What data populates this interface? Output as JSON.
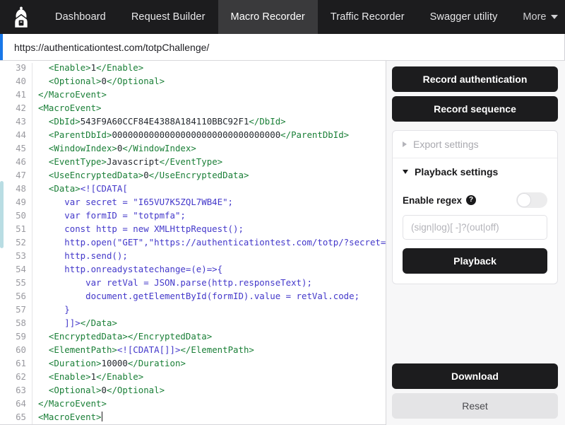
{
  "navbar": {
    "logo_icon": "hooded-spy-logo",
    "tabs": [
      {
        "label": "Dashboard",
        "active": false
      },
      {
        "label": "Request Builder",
        "active": false
      },
      {
        "label": "Macro Recorder",
        "active": true
      },
      {
        "label": "Traffic Recorder",
        "active": false
      },
      {
        "label": "Swagger utility",
        "active": false
      }
    ],
    "more_label": "More",
    "more_caret_icon": "chevron-down-icon",
    "help_icon": "question-mark-circle-icon",
    "help_label": "?"
  },
  "urlbar": {
    "value": "https://authenticationtest.com/totpChallenge/",
    "placeholder": "https://"
  },
  "editor": {
    "first_line_number": 39,
    "lines": [
      {
        "n": 39,
        "segments": [
          {
            "t": "tag",
            "s": "  <Enable>"
          },
          {
            "t": "txt",
            "s": "1"
          },
          {
            "t": "tag",
            "s": "</Enable>"
          }
        ]
      },
      {
        "n": 40,
        "segments": [
          {
            "t": "tag",
            "s": "  <Optional>"
          },
          {
            "t": "txt",
            "s": "0"
          },
          {
            "t": "tag",
            "s": "</Optional>"
          }
        ]
      },
      {
        "n": 41,
        "segments": [
          {
            "t": "tag",
            "s": "</MacroEvent>"
          }
        ]
      },
      {
        "n": 42,
        "segments": [
          {
            "t": "tag",
            "s": "<MacroEvent>"
          }
        ]
      },
      {
        "n": 43,
        "segments": [
          {
            "t": "tag",
            "s": "  <DbId>"
          },
          {
            "t": "txt",
            "s": "543F9A60CCF84E4388A184110BBC92F1"
          },
          {
            "t": "tag",
            "s": "</DbId>"
          }
        ]
      },
      {
        "n": 44,
        "segments": [
          {
            "t": "tag",
            "s": "  <ParentDbId>"
          },
          {
            "t": "txt",
            "s": "00000000000000000000000000000000"
          },
          {
            "t": "tag",
            "s": "</ParentDbId>"
          }
        ]
      },
      {
        "n": 45,
        "segments": [
          {
            "t": "tag",
            "s": "  <WindowIndex>"
          },
          {
            "t": "txt",
            "s": "0"
          },
          {
            "t": "tag",
            "s": "</WindowIndex>"
          }
        ]
      },
      {
        "n": 46,
        "segments": [
          {
            "t": "tag",
            "s": "  <EventType>"
          },
          {
            "t": "txt",
            "s": "Javascript"
          },
          {
            "t": "tag",
            "s": "</EventType>"
          }
        ]
      },
      {
        "n": 47,
        "segments": [
          {
            "t": "tag",
            "s": "  <UseEncryptedData>"
          },
          {
            "t": "txt",
            "s": "0"
          },
          {
            "t": "tag",
            "s": "</UseEncryptedData>"
          }
        ]
      },
      {
        "n": 48,
        "segments": [
          {
            "t": "tag",
            "s": "  <Data>"
          },
          {
            "t": "cdata",
            "s": "<![CDATA["
          }
        ]
      },
      {
        "n": 49,
        "segments": [
          {
            "t": "js",
            "s": "     var secret = \"I65VU7K5ZQL7WB4E\";"
          }
        ]
      },
      {
        "n": 50,
        "segments": [
          {
            "t": "js",
            "s": "     var formID = \"totpmfa\";"
          }
        ]
      },
      {
        "n": 51,
        "segments": [
          {
            "t": "js",
            "s": "     const http = new XMLHttpRequest();"
          }
        ]
      },
      {
        "n": 52,
        "segments": [
          {
            "t": "js",
            "s": "     http.open(\"GET\",\"https://authenticationtest.com/totp/?secret=\" + secret);"
          }
        ]
      },
      {
        "n": 53,
        "segments": [
          {
            "t": "js",
            "s": "     http.send();"
          }
        ]
      },
      {
        "n": 54,
        "segments": [
          {
            "t": "js",
            "s": "     http.onreadystatechange=(e)=>{"
          }
        ]
      },
      {
        "n": 55,
        "segments": [
          {
            "t": "js",
            "s": "         var retVal = JSON.parse(http.responseText);"
          }
        ]
      },
      {
        "n": 56,
        "segments": [
          {
            "t": "js",
            "s": "         document.getElementById(formID).value = retVal.code;"
          }
        ]
      },
      {
        "n": 57,
        "segments": [
          {
            "t": "js",
            "s": "     }"
          }
        ]
      },
      {
        "n": 58,
        "segments": [
          {
            "t": "cdata",
            "s": "     ]]>"
          },
          {
            "t": "tag",
            "s": "</Data>"
          }
        ]
      },
      {
        "n": 59,
        "segments": [
          {
            "t": "tag",
            "s": "  <EncryptedData></EncryptedData>"
          }
        ]
      },
      {
        "n": 60,
        "segments": [
          {
            "t": "tag",
            "s": "  <ElementPath>"
          },
          {
            "t": "cdata",
            "s": "<![CDATA[]]>"
          },
          {
            "t": "tag",
            "s": "</ElementPath>"
          }
        ]
      },
      {
        "n": 61,
        "segments": [
          {
            "t": "tag",
            "s": "  <Duration>"
          },
          {
            "t": "txt",
            "s": "10000"
          },
          {
            "t": "tag",
            "s": "</Duration>"
          }
        ]
      },
      {
        "n": 62,
        "segments": [
          {
            "t": "tag",
            "s": "  <Enable>"
          },
          {
            "t": "txt",
            "s": "1"
          },
          {
            "t": "tag",
            "s": "</Enable>"
          }
        ]
      },
      {
        "n": 63,
        "segments": [
          {
            "t": "tag",
            "s": "  <Optional>"
          },
          {
            "t": "txt",
            "s": "0"
          },
          {
            "t": "tag",
            "s": "</Optional>"
          }
        ]
      },
      {
        "n": 64,
        "segments": [
          {
            "t": "tag",
            "s": "</MacroEvent>"
          }
        ]
      },
      {
        "n": 65,
        "segments": [
          {
            "t": "tag",
            "s": "<MacroEvent>"
          }
        ],
        "caret": true
      }
    ],
    "colors": {
      "tag": "#1a7f37",
      "text": "#24292f",
      "js": "#4338ca",
      "cdata": "#4338ca",
      "gutter": "#9a9aa0"
    }
  },
  "right_panel": {
    "record_authentication_label": "Record authentication",
    "record_sequence_label": "Record sequence",
    "export_settings": {
      "label": "Export settings",
      "expanded": false,
      "caret_icon": "triangle-right-icon"
    },
    "playback_settings": {
      "label": "Playback settings",
      "expanded": true,
      "caret_icon": "triangle-down-icon",
      "enable_regex_label": "Enable regex",
      "enable_regex_help_icon": "help-question-icon",
      "enable_regex_on": false,
      "regex_input_value": "",
      "regex_input_placeholder": "(sign|log)[ -]?(out|off)",
      "playback_label": "Playback"
    },
    "download_label": "Download",
    "reset_label": "Reset"
  },
  "colors": {
    "dark": "#1c1c1e",
    "active_tab": "#3a3a3c",
    "accent_blue": "#1877e8",
    "panel_bg": "#f7f7f8",
    "grey_button": "#e4e4e6"
  }
}
